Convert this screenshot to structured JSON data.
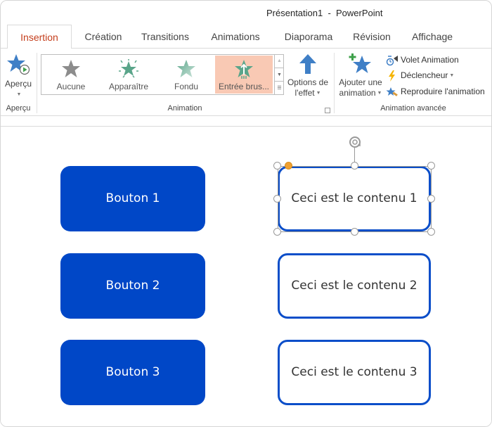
{
  "window": {
    "title": "Présentation1  -  PowerPoint"
  },
  "tabs": [
    {
      "label": "Insertion",
      "active": true
    },
    {
      "label": "Création",
      "active": false
    },
    {
      "label": "Transitions",
      "active": false
    },
    {
      "label": "Animations",
      "active": false
    },
    {
      "label": "Diaporama",
      "active": false
    },
    {
      "label": "Révision",
      "active": false
    },
    {
      "label": "Affichage",
      "active": false
    }
  ],
  "ribbon": {
    "groups": {
      "apercu": {
        "label": "Aperçu",
        "button_label": "Aperçu",
        "icon": "star-play-icon"
      },
      "animation": {
        "label": "Animation",
        "gallery": [
          {
            "label": "Aucune",
            "icon": "star-gray-icon",
            "selected": false
          },
          {
            "label": "Apparaître",
            "icon": "star-burst-icon",
            "selected": false
          },
          {
            "label": "Fondu",
            "icon": "star-fade-icon",
            "selected": false
          },
          {
            "label": "Entrée brus...",
            "icon": "star-fly-in-icon",
            "selected": true
          }
        ],
        "effect_options_line1": "Options de",
        "effect_options_line2": "l'effet"
      },
      "advanced": {
        "label": "Animation avancée",
        "add_animation_line1": "Ajouter une",
        "add_animation_line2": "animation",
        "animation_pane": "Volet Animation",
        "trigger": "Déclencheur",
        "animation_painter": "Reproduire l'animation"
      }
    },
    "colors": {
      "selected_gallery": "#f9c9b4",
      "active_tab": "#c43e1c",
      "icon_blue": "#3f7fc6",
      "icon_green": "#5aa58a"
    }
  },
  "slide": {
    "buttons": [
      {
        "label": "Bouton 1"
      },
      {
        "label": "Bouton 2"
      },
      {
        "label": "Bouton 3"
      }
    ],
    "contents": [
      {
        "label": "Ceci est le contenu 1",
        "selected": true
      },
      {
        "label": "Ceci est le contenu 2",
        "selected": false
      },
      {
        "label": "Ceci est le contenu 3",
        "selected": false
      }
    ],
    "colors": {
      "button_fill": "#0047c7",
      "content_border": "#0b4ec9"
    }
  }
}
